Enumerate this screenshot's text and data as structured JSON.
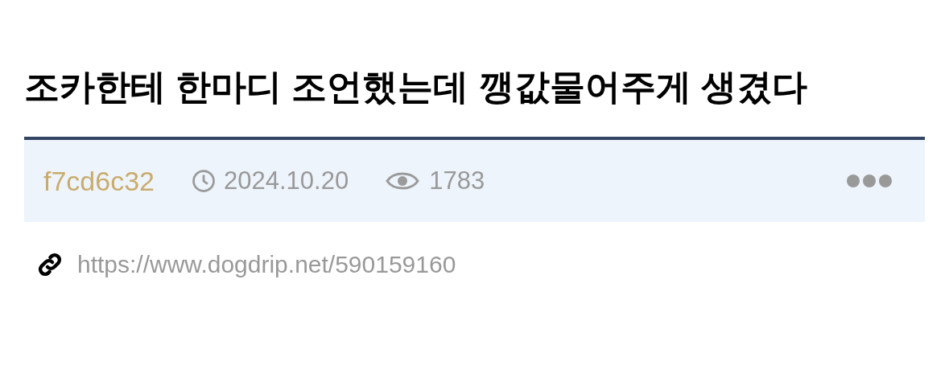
{
  "title": "조카한테 한마디 조언했는데 깽값물어주게 생겼다",
  "meta": {
    "author": "f7cd6c32",
    "date": "2024.10.20",
    "views": "1783"
  },
  "link": {
    "url": "https://www.dogdrip.net/590159160"
  }
}
